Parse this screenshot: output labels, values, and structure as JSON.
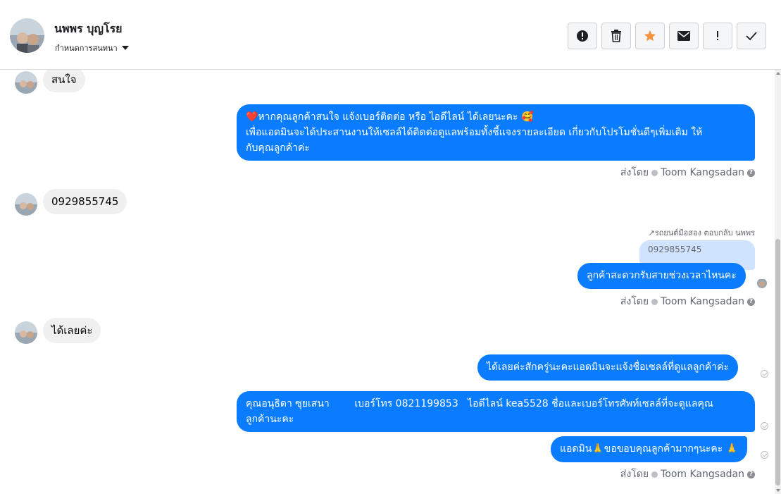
{
  "header": {
    "contact_name": "นพพร บุญโรย",
    "conversation_menu": "กำหนดการสนทนา",
    "actions": [
      {
        "icon": "alert-circle-icon"
      },
      {
        "icon": "trash-icon"
      },
      {
        "icon": "star-icon",
        "color": "#f7923b"
      },
      {
        "icon": "envelope-icon"
      },
      {
        "icon": "exclamation-icon"
      },
      {
        "icon": "check-icon"
      }
    ]
  },
  "messages": {
    "m1": {
      "text": "สนใจ"
    },
    "m2": {
      "line1": "❤️หากคุณลูกค้าสนใจ แจ้งเบอร์ติดต่อ หรือ ไอดีไลน์ ได้เลยนะคะ 🥰",
      "line2": "เพื่อแอดมินจะได้ประสานงานให้เซลล์ได้ติดต่อดูแลพร้อมทั้งชี้แจงรายละเอียด เกี่ยวกับโปรโมชั่นดีๆเพิ่มเติม ให้",
      "line3": "กับคุณลูกค้าค่ะ"
    },
    "sent_by_1": "ส่งโดย",
    "agent_1": "Toom Kangsadan",
    "m3": {
      "text": "0929855745"
    },
    "reply_note": "↗รถยนต์มือสอง ตอบกลับ นพพร",
    "quoted": "0929855745",
    "m4": {
      "text": "ลูกค้าสะดวกรับสายช่วงเวลาไหนคะ"
    },
    "sent_by_2": "ส่งโดย",
    "agent_2": "Toom Kangsadan",
    "m5": {
      "text": "ได้เลยค่ะ"
    },
    "m6": {
      "text": "ได้เลยค่ะสักครู่นะคะแอดมินจะแจ้งชื่อเซลล์ที่ดูแลลูกค้าค่ะ"
    },
    "m7": {
      "line1": "คุณอนุธิดา ซุยเสนา        เบอร์โทร 0821199853   ไอดีไลน์ kea5528 ชื่อและเบอร์โทรศัพท์เซลล์ที่จะดูแลคุณ",
      "line2": "ลูกค้านะคะ"
    },
    "m8": {
      "text": "แอดมิน🙏ขอขอบคุณลูกค้ามากๆนะคะ 🙏"
    },
    "sent_by_3": "ส่งโดย",
    "agent_3": "Toom Kangsadan"
  },
  "colors": {
    "outgoing": "#0a7cff",
    "incoming": "#f0f0f0",
    "star": "#f7923b"
  }
}
